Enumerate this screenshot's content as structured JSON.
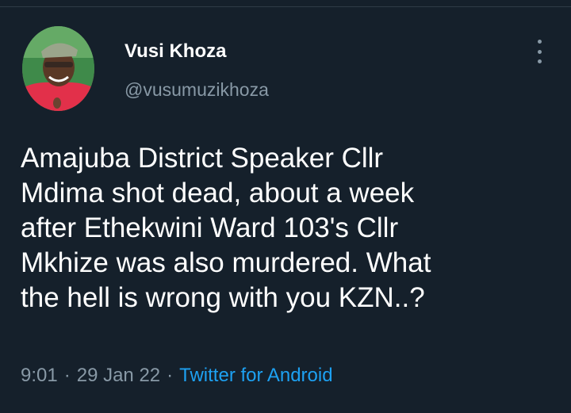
{
  "author": {
    "name": "Vusi Khoza",
    "handle": "@vusumuzikhoza"
  },
  "tweet": {
    "text": "Amajuba District Speaker Cllr\nMdima shot dead, about a week\nafter Ethekwini Ward 103's Cllr\nMkhize was also murdered. What\nthe hell is wrong with you KZN..?",
    "time": "9:01",
    "separator": "·",
    "date": "29 Jan 22",
    "source": "Twitter for Android"
  },
  "icons": {
    "more": "more-vertical-icon"
  },
  "colors": {
    "background": "#15202b",
    "secondary_text": "#8899a6",
    "link": "#1da1f2"
  }
}
